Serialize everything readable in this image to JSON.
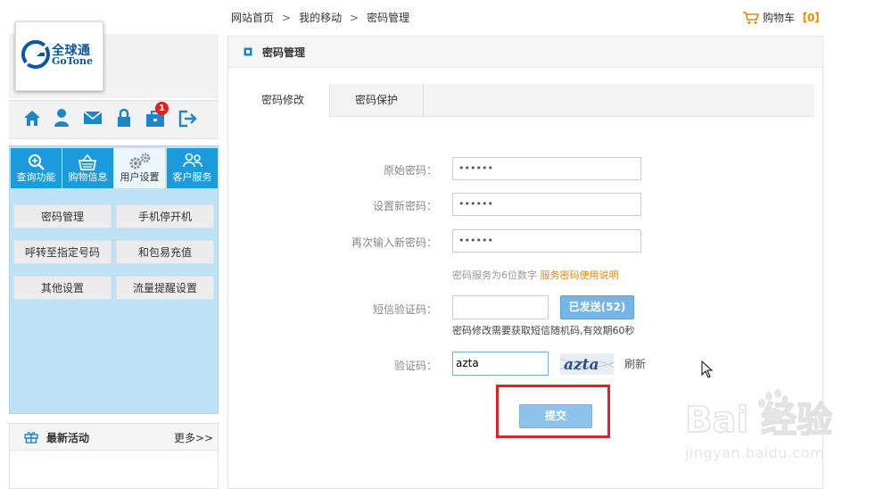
{
  "breadcrumb": {
    "home": "网站首页",
    "sep1": ">",
    "my": "我的移动",
    "sep2": ">",
    "current": "密码管理"
  },
  "cart": {
    "label": "购物车",
    "count": "【0】"
  },
  "logo": {
    "cn": "全球通",
    "en": "GoTone"
  },
  "top_icons": {
    "home": "home-icon",
    "user": "user-icon",
    "mail": "mail-icon",
    "lock": "lock-icon",
    "bag": "bag-icon",
    "logout": "logout-icon",
    "badge": "1"
  },
  "function_tabs": [
    {
      "label": "查询功能",
      "icon": "search-icon"
    },
    {
      "label": "购物信息",
      "icon": "basket-icon"
    },
    {
      "label": "用户设置",
      "icon": "gears-icon"
    },
    {
      "label": "客户服务",
      "icon": "people-icon"
    }
  ],
  "sub_menu": [
    "密码管理",
    "手机停开机",
    "呼转至指定号码",
    "和包易充值",
    "其他设置",
    "流量提醒设置"
  ],
  "news": {
    "title": "最新活动",
    "more": "更多>>"
  },
  "panel": {
    "title": "密码管理"
  },
  "tabs": [
    "密码修改",
    "密码保护"
  ],
  "form": {
    "old_password_label": "原始密码：",
    "old_password_value": "••••••",
    "new_password_label": "设置新密码：",
    "new_password_value": "••••••",
    "confirm_password_label": "再次输入新密码：",
    "confirm_password_value": "••••••",
    "password_hint": "密码服务为6位数字",
    "password_hint_link": "服务密码使用说明",
    "sms_label": "短信验证码：",
    "sms_value": "",
    "sms_button": "已发送(52)",
    "sms_hint": "密码修改需要获取短信随机码,有效期60秒",
    "captcha_label": "验证码：",
    "captcha_value": "azta",
    "captcha_image_text": "azta",
    "refresh": "刷新",
    "submit": "提交"
  },
  "watermark": {
    "logo_text": "Bai  经验",
    "url": "jingyan.baidu.com"
  },
  "colors": {
    "tab_blue": "#1c9bdc",
    "panel_blue": "#bfe2f6",
    "link_orange": "#e88a19",
    "submit_blue": "#8dc3ea",
    "highlight_red": "#d8242b"
  }
}
